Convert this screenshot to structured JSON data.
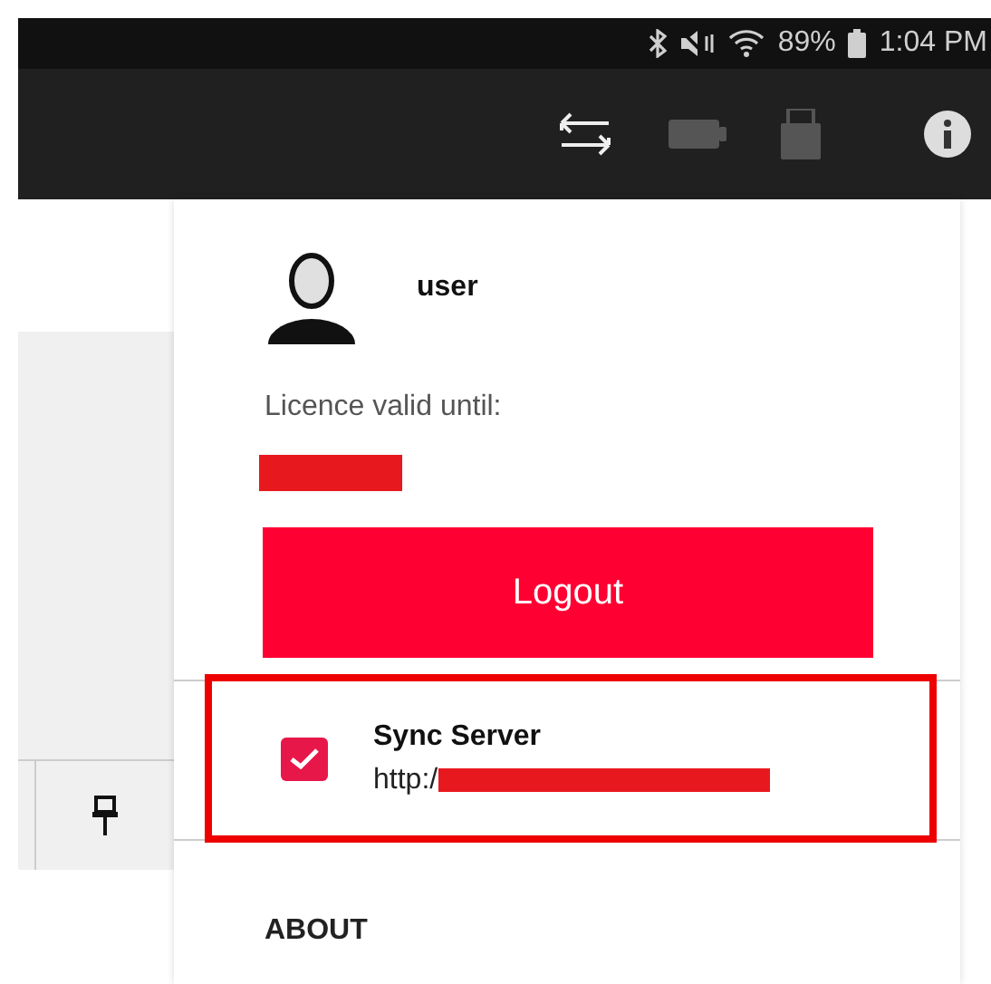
{
  "status_bar": {
    "battery": "89%",
    "time": "1:04 PM"
  },
  "menu": {
    "user": "user",
    "licence_label": "Licence valid until:",
    "logout": "Logout",
    "sync": {
      "title": "Sync Server",
      "url": "http:/",
      "checked": true,
      "highlighted": true
    },
    "about": "ABOUT"
  }
}
